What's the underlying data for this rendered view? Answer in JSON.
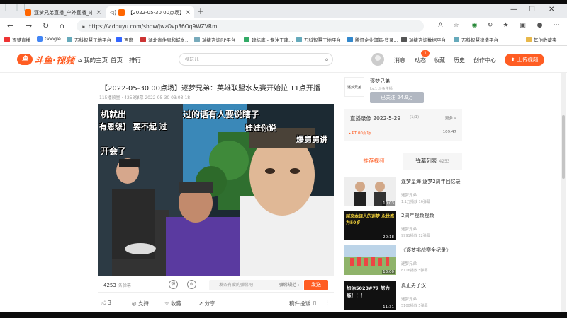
{
  "browser": {
    "tabs": [
      {
        "title": "逐梦兄弟直播_户外直播_斗鱼直…"
      },
      {
        "title": "【2022-05-30 00点场】逐…"
      }
    ],
    "url": "https://v.douyu.com/show/jwzOvp36Oq9WZVRm"
  },
  "bookmarks": [
    {
      "label": "逐梦直播"
    },
    {
      "label": "Google"
    },
    {
      "label": "万科智慧工地平台"
    },
    {
      "label": "百度"
    },
    {
      "label": "湖北省住房和城乡…"
    },
    {
      "label": "瑞捷咨询RP平台"
    },
    {
      "label": "建标库 - 专注于建…"
    },
    {
      "label": "万科智慧工地平台"
    },
    {
      "label": "腾讯企业邮箱-登录…"
    },
    {
      "label": "瑞捷咨询数据平台"
    },
    {
      "label": "万科智慧建造平台"
    },
    {
      "label": "其他收藏夹"
    }
  ],
  "site": {
    "logo": "斗鱼·视频",
    "nav": [
      "我的主页",
      "首页",
      "排行"
    ],
    "search_placeholder": "搜玩儿",
    "header_items": [
      "消息",
      "动态",
      "收藏",
      "历史",
      "创作中心"
    ],
    "dynamic_badge": "1",
    "upload_label": "上传视频"
  },
  "video": {
    "title": "【2022-05-30 00点场】逐梦兄弟：英雄联盟水友赛开始拉 11点开播",
    "meta": "115播放量 · 4253弹幕   2022-05-30 03:03:18",
    "overlays": [
      "机就出",
      "过的话有人要说瞎子",
      "有恩怨】 要不起   过",
      "娃娃你说",
      "爆舅舅讲",
      "开会了"
    ],
    "danmu_count": "4253",
    "danmu_unit": "条弹幕",
    "danmu_placeholder": "发条有爱的弹幕吧",
    "danmu_settings": "弹幕规范 ▸",
    "send_label": "发送",
    "likes": "3",
    "support_label": "支持",
    "collect_label": "收藏",
    "share_label": "分享",
    "report_label": "稿件投诉"
  },
  "author": {
    "avatar_label": "逐梦兄弟",
    "name": "逐梦兄弟",
    "subtitle": "Lv.1 斗鱼主播",
    "follow_label": "已关注  24.9万"
  },
  "replay": {
    "title": "直播录像 2022-5-29",
    "page": "(1/1)",
    "more": "更多 »",
    "item": "▸ PT 00点场",
    "duration": "109:47"
  },
  "side_tabs": {
    "recommend": "推荐视频",
    "danmu": "弹幕列表",
    "danmu_count": "4253"
  },
  "recommendations": [
    {
      "title": "逐梦星海 逐梦2周年回忆录",
      "author": "逐梦兄弟",
      "stats": "1.1万播放   16弹幕",
      "duration": "10:03"
    },
    {
      "title": "2周年视频视频",
      "author": "逐梦兄弟",
      "stats": "9991播放   12弹幕",
      "duration": "20:18",
      "thumb_text": "越来本饶人的逐梦 永世感为50岁"
    },
    {
      "title": "《逐梦挑战赛全纪录》",
      "author": "逐梦兄弟",
      "stats": "8116播放   5弹幕",
      "duration": "13:00"
    },
    {
      "title": "真正男子汉",
      "author": "逐梦兄弟",
      "stats": "5100播放   5弹幕",
      "duration": "11:31",
      "thumb_text": "加油5023#77 努力练！！！"
    }
  ],
  "colors": {
    "brand": "#ff5d23",
    "follow": "#b2b8c2"
  }
}
